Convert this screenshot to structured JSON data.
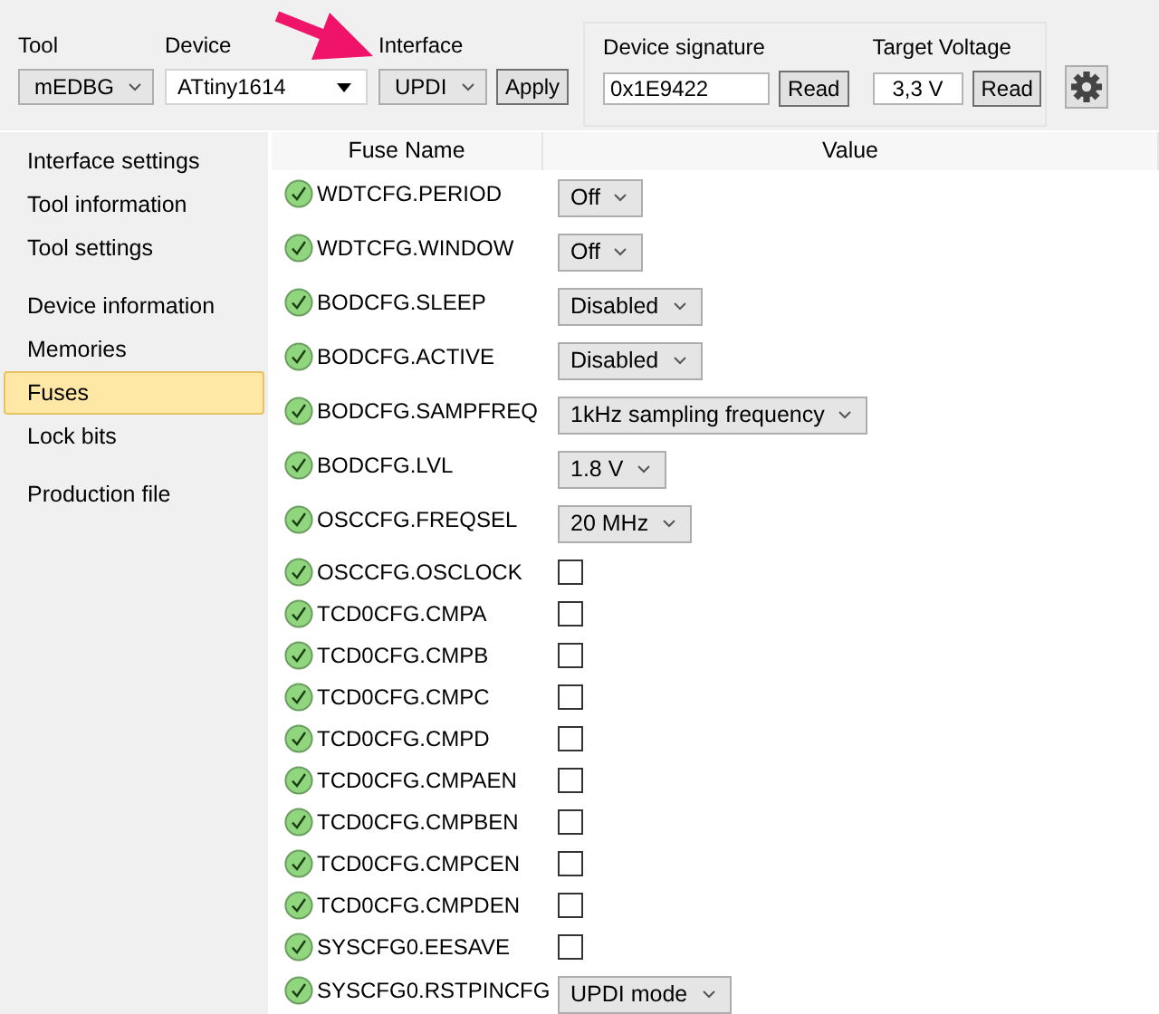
{
  "toolbar": {
    "tool": {
      "label": "Tool",
      "value": "mEDBG"
    },
    "device": {
      "label": "Device",
      "value": "ATtiny1614"
    },
    "interface": {
      "label": "Interface",
      "value": "UPDI",
      "button": "Apply"
    },
    "signature": {
      "label": "Device signature",
      "value": "0x1E9422",
      "button": "Read"
    },
    "voltage": {
      "label": "Target Voltage",
      "value": "3,3 V",
      "button": "Read"
    }
  },
  "sidebar": {
    "groups": [
      [
        {
          "label": "Interface settings",
          "selected": false
        },
        {
          "label": "Tool information",
          "selected": false
        },
        {
          "label": "Tool settings",
          "selected": false
        }
      ],
      [
        {
          "label": "Device information",
          "selected": false
        },
        {
          "label": "Memories",
          "selected": false
        },
        {
          "label": "Fuses",
          "selected": true
        },
        {
          "label": "Lock bits",
          "selected": false
        }
      ],
      [
        {
          "label": "Production file",
          "selected": false
        }
      ]
    ]
  },
  "fuses": {
    "columns": [
      "Fuse Name",
      "Value"
    ],
    "rows": [
      {
        "name": "WDTCFG.PERIOD",
        "kind": "select",
        "value": "Off"
      },
      {
        "name": "WDTCFG.WINDOW",
        "kind": "select",
        "value": "Off"
      },
      {
        "name": "BODCFG.SLEEP",
        "kind": "select",
        "value": "Disabled"
      },
      {
        "name": "BODCFG.ACTIVE",
        "kind": "select",
        "value": "Disabled"
      },
      {
        "name": "BODCFG.SAMPFREQ",
        "kind": "select",
        "value": "1kHz sampling frequency"
      },
      {
        "name": "BODCFG.LVL",
        "kind": "select",
        "value": "1.8 V"
      },
      {
        "name": "OSCCFG.FREQSEL",
        "kind": "select",
        "value": "20 MHz"
      },
      {
        "name": "OSCCFG.OSCLOCK",
        "kind": "checkbox",
        "checked": false
      },
      {
        "name": "TCD0CFG.CMPA",
        "kind": "checkbox",
        "checked": false
      },
      {
        "name": "TCD0CFG.CMPB",
        "kind": "checkbox",
        "checked": false
      },
      {
        "name": "TCD0CFG.CMPC",
        "kind": "checkbox",
        "checked": false
      },
      {
        "name": "TCD0CFG.CMPD",
        "kind": "checkbox",
        "checked": false
      },
      {
        "name": "TCD0CFG.CMPAEN",
        "kind": "checkbox",
        "checked": false
      },
      {
        "name": "TCD0CFG.CMPBEN",
        "kind": "checkbox",
        "checked": false
      },
      {
        "name": "TCD0CFG.CMPCEN",
        "kind": "checkbox",
        "checked": false
      },
      {
        "name": "TCD0CFG.CMPDEN",
        "kind": "checkbox",
        "checked": false
      },
      {
        "name": "SYSCFG0.EESAVE",
        "kind": "checkbox",
        "checked": false
      },
      {
        "name": "SYSCFG0.RSTPINCFG",
        "kind": "select",
        "value": "UPDI mode"
      }
    ]
  }
}
